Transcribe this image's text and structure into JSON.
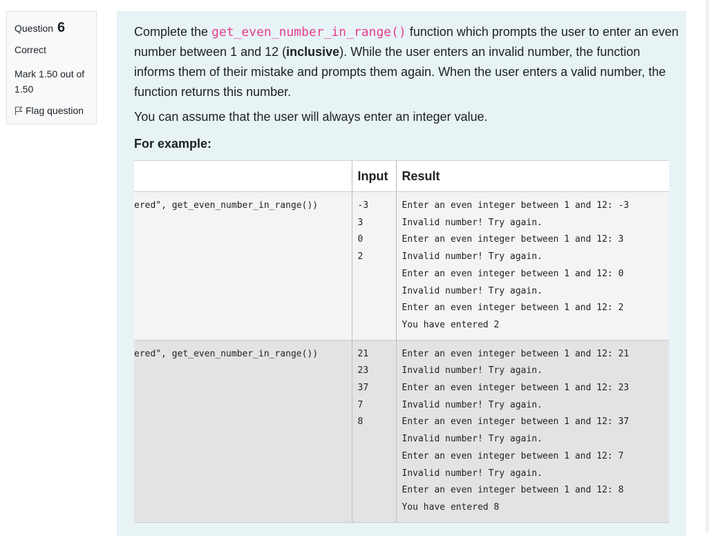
{
  "info": {
    "question_label": "Question",
    "question_number": "6",
    "state": "Correct",
    "grade": "Mark 1.50 out of 1.50",
    "flag_label": "Flag question"
  },
  "question": {
    "intro_before": "Complete the ",
    "function_name": "get_even_number_in_range()",
    "intro_after_1": " function which prompts the user to enter an even number between 1 and 12 (",
    "inclusive": "inclusive",
    "intro_after_2": "). While the user enters an invalid number, the function informs them of their mistake and prompts them again. When the user enters a valid number, the function returns this number.",
    "assumption": "You can assume that the user will always enter an integer value.",
    "example_heading": "For example:"
  },
  "table": {
    "headers": {
      "test": "",
      "input": "Input",
      "result": "Result"
    },
    "rows": [
      {
        "test": "ered\", get_even_number_in_range())",
        "input": [
          "-3",
          "3",
          "0",
          "2"
        ],
        "result": [
          "Enter an even integer between 1 and 12: -3",
          "Invalid number! Try again.",
          "Enter an even integer between 1 and 12: 3",
          "Invalid number! Try again.",
          "Enter an even integer between 1 and 12: 0",
          "Invalid number! Try again.",
          "Enter an even integer between 1 and 12: 2",
          "You have entered 2"
        ]
      },
      {
        "test": "ered\", get_even_number_in_range())",
        "input": [
          "21",
          "23",
          "37",
          "7",
          "8"
        ],
        "result": [
          "Enter an even integer between 1 and 12: 21",
          "Invalid number! Try again.",
          "Enter an even integer between 1 and 12: 23",
          "Invalid number! Try again.",
          "Enter an even integer between 1 and 12: 37",
          "Invalid number! Try again.",
          "Enter an even integer between 1 and 12: 7",
          "Invalid number! Try again.",
          "Enter an even integer between 1 and 12: 8",
          "You have entered 8"
        ]
      }
    ]
  },
  "colors": {
    "info_bg": "#f8f9fa",
    "content_bg": "#e7f3f5",
    "code": "#e83e8c",
    "row1_bg": "#f4f4f4",
    "row2_bg": "#e3e3e3"
  }
}
